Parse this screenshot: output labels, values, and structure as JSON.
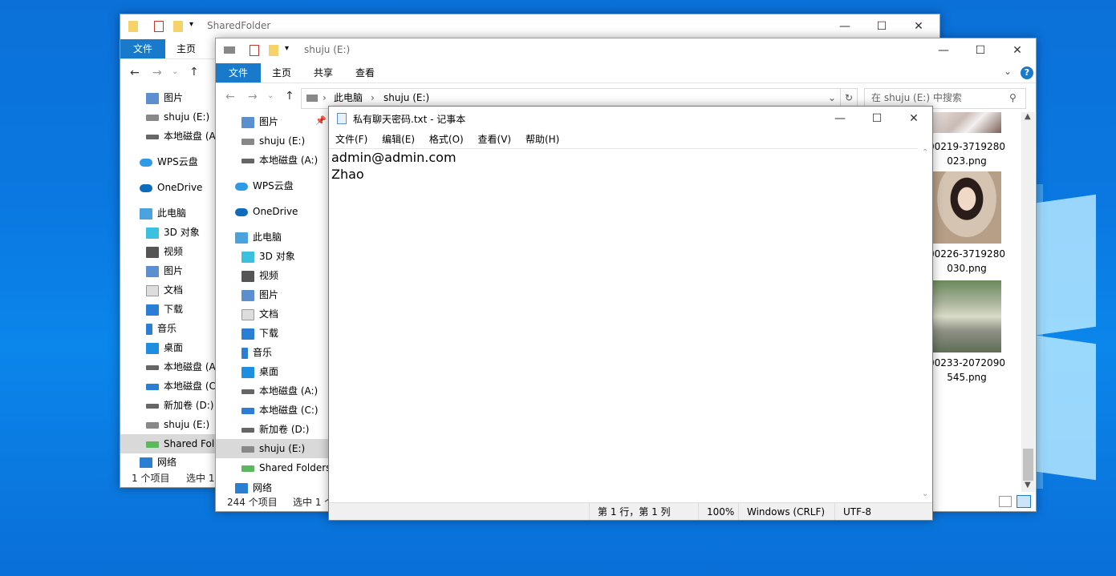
{
  "explorer_back": {
    "title": "SharedFolder",
    "tabs": [
      "文件",
      "主页"
    ],
    "sidebar": [
      "图片",
      "shuju (E:)",
      "本地磁盘 (A:)",
      "WPS云盘",
      "OneDrive",
      "此电脑",
      "3D 对象",
      "视频",
      "图片",
      "文档",
      "下载",
      "音乐",
      "桌面",
      "本地磁盘 (A:)",
      "本地磁盘 (C:)",
      "新加卷 (D:)",
      "shuju (E:)",
      "Shared Folders",
      "网络"
    ],
    "status_count": "1 个项目",
    "status_selected": "选中 1"
  },
  "explorer_front": {
    "title": "shuju (E:)",
    "tabs": [
      "文件",
      "主页",
      "共享",
      "查看"
    ],
    "breadcrumb": [
      "此电脑",
      "shuju (E:)"
    ],
    "search_placeholder": "在 shuju (E:) 中搜索",
    "sidebar": [
      "图片",
      "shuju (E:)",
      "本地磁盘 (A:)",
      "WPS云盘",
      "OneDrive",
      "此电脑",
      "3D 对象",
      "视频",
      "图片",
      "文档",
      "下载",
      "音乐",
      "桌面",
      "本地磁盘 (A:)",
      "本地磁盘 (C:)",
      "新加卷 (D:)",
      "shuju (E:)",
      "Shared Folders",
      "网络"
    ],
    "files": [
      {
        "line1": "00219-3719280",
        "line2": "023.png"
      },
      {
        "line1": "00226-3719280",
        "line2": "030.png"
      },
      {
        "line1": "00233-2072090",
        "line2": "545.png"
      }
    ],
    "status_count": "244 个项目",
    "status_selected": "选中 1 个"
  },
  "notepad": {
    "title": "私有聊天密码.txt - 记事本",
    "menu": [
      "文件(F)",
      "编辑(E)",
      "格式(O)",
      "查看(V)",
      "帮助(H)"
    ],
    "lines": [
      "admin@admin.com",
      "Zhao"
    ],
    "status": {
      "position": "第 1 行，第 1 列",
      "zoom": "100%",
      "line_ending": "Windows (CRLF)",
      "encoding": "UTF-8"
    }
  },
  "colors": {
    "accent": "#1979ca",
    "desktop": "#0a6fd8"
  }
}
